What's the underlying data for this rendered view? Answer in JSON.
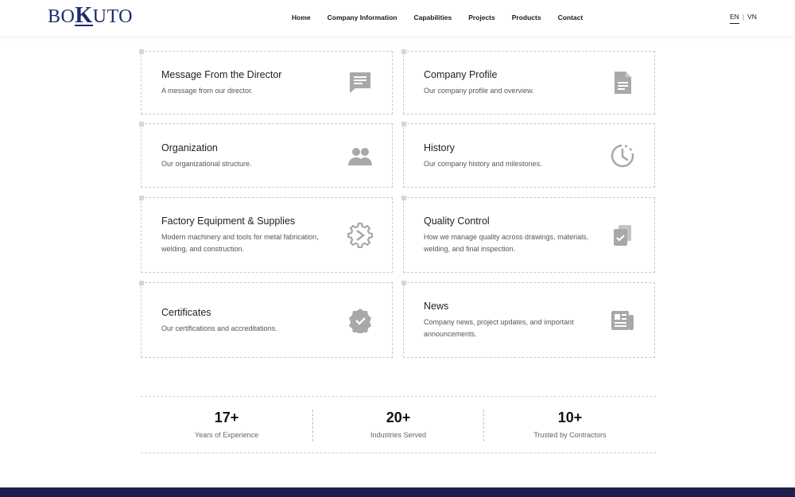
{
  "header": {
    "logo": {
      "part1": "BO",
      "part2": "K",
      "part3": "UTO"
    },
    "nav": [
      "Home",
      "Company Information",
      "Capabilities",
      "Projects",
      "Products",
      "Contact"
    ],
    "lang": {
      "active": "EN",
      "sep": "|",
      "other": "VN"
    }
  },
  "cards": [
    {
      "title": "Message From the Director",
      "desc": "A message from our director.",
      "icon": "message-icon"
    },
    {
      "title": "Company Profile",
      "desc": "Our company profile and overview.",
      "icon": "document-icon"
    },
    {
      "title": "Organization",
      "desc": "Our organizational structure.",
      "icon": "people-icon"
    },
    {
      "title": "History",
      "desc": "Our company history and milestones.",
      "icon": "history-icon"
    },
    {
      "title": "Factory Equipment & Supplies",
      "desc": "Modern machinery and tools for metal fabrication, welding, and construction.",
      "icon": "gear-icon"
    },
    {
      "title": "Quality Control",
      "desc": "How we manage quality across drawings, materials, welding, and final inspection.",
      "icon": "clipboard-check-icon"
    },
    {
      "title": "Certificates",
      "desc": "Our certifications and accreditations.",
      "icon": "badge-check-icon"
    },
    {
      "title": "News",
      "desc": "Company news, project updates, and important announcements.",
      "icon": "newspaper-icon"
    }
  ],
  "stats": [
    {
      "num": "17+",
      "label": "Years of Experience"
    },
    {
      "num": "20+",
      "label": "Industries Served"
    },
    {
      "num": "10+",
      "label": "Trusted by Contractors"
    }
  ],
  "colors": {
    "brand": "#1e2a6b",
    "footer": "#1c1f4c",
    "icon": "#a8a8a8"
  }
}
